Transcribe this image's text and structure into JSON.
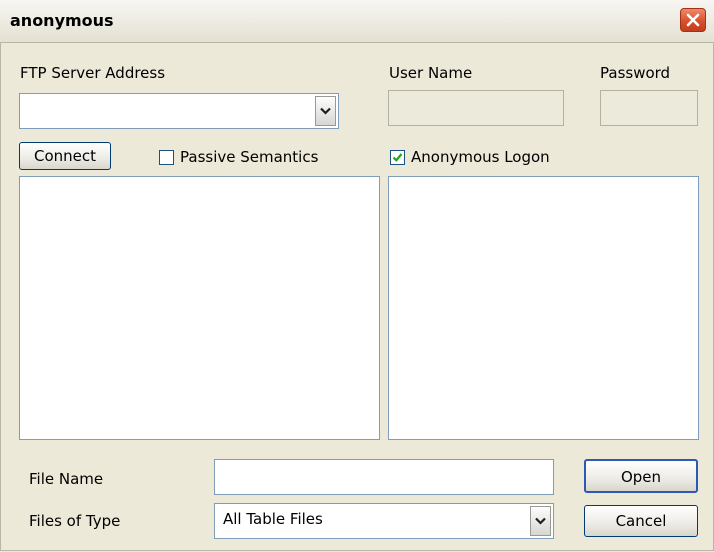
{
  "window": {
    "title": "anonymous"
  },
  "ftp": {
    "server_address_label": "FTP Server Address",
    "server_address_value": "",
    "user_name_label": "User Name",
    "user_name_value": "",
    "password_label": "Password",
    "password_value": "",
    "connect_label": "Connect",
    "passive_label": "Passive Semantics",
    "passive_checked": false,
    "anonymous_label": "Anonymous Logon",
    "anonymous_checked": true
  },
  "lists": {
    "local_items": [],
    "remote_items": []
  },
  "footer": {
    "file_name_label": "File Name",
    "file_name_value": "",
    "files_of_type_label": "Files of Type",
    "files_of_type_value": "All Table Files",
    "open_label": "Open",
    "cancel_label": "Cancel"
  },
  "icons": {
    "close": "close-icon",
    "dropdown": "chevron-down-icon",
    "check": "check-icon"
  },
  "colors": {
    "dialog_bg": "#ece9d8",
    "close_red": "#d8502f",
    "check_green": "#21a121",
    "field_border": "#7f9db9"
  }
}
